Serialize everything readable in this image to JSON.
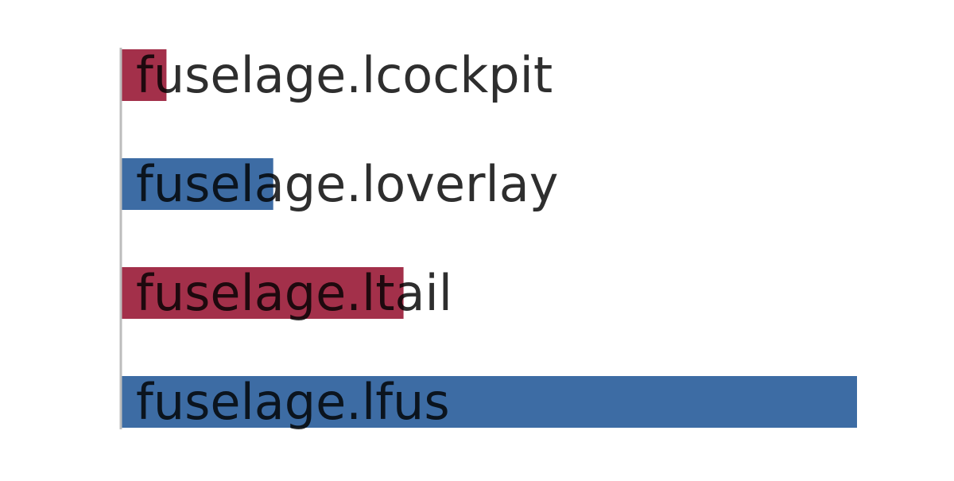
{
  "chart_data": {
    "type": "bar",
    "orientation": "horizontal",
    "categories": [
      "fuselage.lcockpit",
      "fuselage.loverlay",
      "fuselage.ltail",
      "fuselage.lfus"
    ],
    "values": [
      0.062,
      0.207,
      0.384,
      1.0
    ],
    "value_scale": "relative (fraction of longest bar; no axis ticks printed)",
    "bar_colors": [
      "#a3304a",
      "#3d6ca4",
      "#a3304a",
      "#3d6ca4"
    ],
    "title": "",
    "xlabel": "",
    "ylabel": "",
    "xlim": [
      0,
      1.0
    ],
    "grid": false,
    "legend": "none",
    "label_placement": "inside-bar-start",
    "colors": {
      "background": "#ffffff",
      "axis_line": "#bdbdbd",
      "label_text": "#2e2e2e"
    }
  }
}
